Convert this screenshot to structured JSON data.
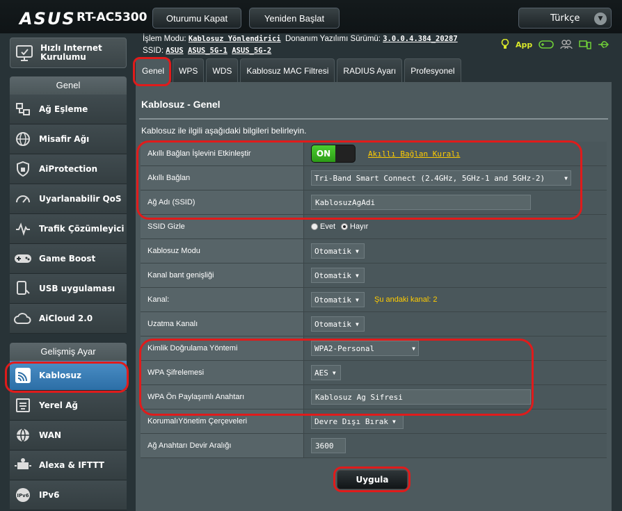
{
  "header": {
    "brand": "ASUS",
    "model": "RT-AC5300",
    "logout_label": "Oturumu Kapat",
    "reboot_label": "Yeniden Başlat",
    "language": "Türkçe"
  },
  "info": {
    "mode_label": "İşlem Modu:",
    "mode_value": "Kablosuz Yönlendirici",
    "firmware_label": "Donanım Yazılımı Sürümü:",
    "firmware_value": "3.0.0.4.384_20287",
    "ssid_label": "SSID:",
    "ssid_1": "ASUS",
    "ssid_2": "ASUS_5G-1",
    "ssid_3": "ASUS_5G-2",
    "app_label": "App"
  },
  "sidebar": {
    "quick_setup": "Hızlı Internet Kurulumu",
    "general_title": "Genel",
    "general_items": [
      {
        "label": "Ağ Eşleme",
        "icon": "network-map-icon"
      },
      {
        "label": "Misafir Ağı",
        "icon": "globe-icon"
      },
      {
        "label": "AiProtection",
        "icon": "shield-icon"
      },
      {
        "label": "Uyarlanabilir QoS",
        "icon": "gauge-icon"
      },
      {
        "label": "Trafik Çözümleyici",
        "icon": "traffic-icon"
      },
      {
        "label": "Game Boost",
        "icon": "gamepad-icon"
      },
      {
        "label": "USB uygulaması",
        "icon": "usb-icon"
      },
      {
        "label": "AiCloud 2.0",
        "icon": "cloud-icon"
      }
    ],
    "advanced_title": "Gelişmiş Ayar",
    "advanced_items": [
      {
        "label": "Kablosuz",
        "icon": "wifi-icon",
        "active": true
      },
      {
        "label": "Yerel Ağ",
        "icon": "lan-icon"
      },
      {
        "label": "WAN",
        "icon": "wan-globe-icon"
      },
      {
        "label": "Alexa & IFTTT",
        "icon": "alexa-icon"
      },
      {
        "label": "IPv6",
        "icon": "ipv6-icon"
      }
    ]
  },
  "tabs": [
    {
      "label": "Genel",
      "active": true
    },
    {
      "label": "WPS"
    },
    {
      "label": "WDS"
    },
    {
      "label": "Kablosuz MAC Filtresi"
    },
    {
      "label": "RADIUS Ayarı"
    },
    {
      "label": "Profesyonel"
    }
  ],
  "panel": {
    "title": "Kablosuz - Genel",
    "description": "Kablosuz ile ilgili aşağıdaki bilgileri belirleyin.",
    "rows": {
      "smart_connect_enable": {
        "label": "Akıllı Bağlan İşlevini Etkinleştir",
        "toggle": "ON",
        "link": "Akıllı Bağlan Kuralı"
      },
      "smart_connect": {
        "label": "Akıllı Bağlan",
        "value": "Tri-Band Smart Connect (2.4GHz, 5GHz-1 and 5GHz-2)"
      },
      "ssid": {
        "label": "Ağ Adı (SSID)",
        "value": "KablosuzAgAdi"
      },
      "hide_ssid": {
        "label": "SSID Gizle",
        "opt_yes": "Evet",
        "opt_no": "Hayır"
      },
      "wireless_mode": {
        "label": "Kablosuz Modu",
        "value": "Otomatik"
      },
      "bandwidth": {
        "label": "Kanal bant genişliği",
        "value": "Otomatik"
      },
      "channel": {
        "label": "Kanal:",
        "value": "Otomatik",
        "note": "Şu andaki kanal: 2"
      },
      "ext_channel": {
        "label": "Uzatma Kanalı",
        "value": "Otomatik"
      },
      "auth": {
        "label": "Kimlik Doğrulama Yöntemi",
        "value": "WPA2-Personal"
      },
      "wpa_enc": {
        "label": "WPA Şifrelemesi",
        "value": "AES"
      },
      "wpa_key": {
        "label": "WPA Ön Paylaşımlı Anahtarı",
        "value": "Kablosuz Ag Sifresi"
      },
      "pmf": {
        "label": "KorumalıYönetim Çerçeveleri",
        "value": "Devre Dışı Bırak"
      },
      "key_rotation": {
        "label": "Ağ Anahtarı Devir Aralığı",
        "value": "3600"
      }
    },
    "apply_label": "Uygula"
  },
  "colors": {
    "highlight": "#e01b1b",
    "active_item": "#3b7fb8",
    "warning_text": "#ffcc00",
    "toggle_on": "#3cb521"
  }
}
